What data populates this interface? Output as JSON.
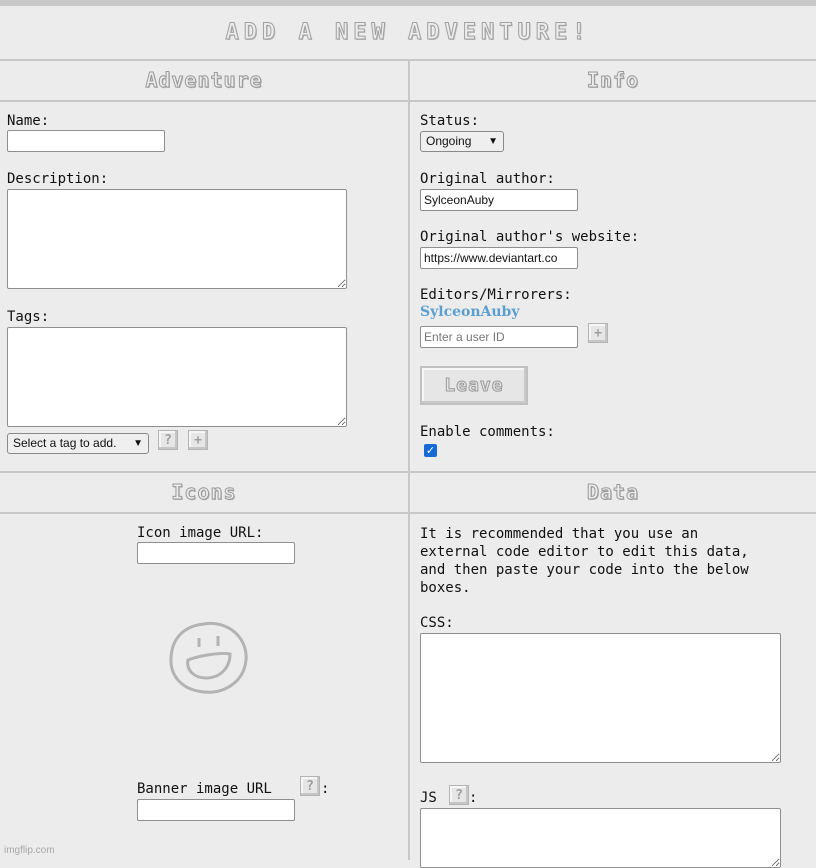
{
  "page_title": "ADD A NEW ADVENTURE!",
  "sections": {
    "adventure": "Adventure",
    "info": "Info",
    "icons": "Icons",
    "data": "Data"
  },
  "adventure": {
    "name_label": "Name:",
    "name_value": "",
    "description_label": "Description:",
    "tags_label": "Tags:",
    "tag_select_value": "Select a tag to add.",
    "help_glyph": "?",
    "add_glyph": "+"
  },
  "info": {
    "status_label": "Status:",
    "status_value": "Ongoing",
    "author_label": "Original author:",
    "author_value": "SylceonAuby",
    "website_label": "Original author's website:",
    "website_value": "https://www.deviantart.co",
    "editors_label": "Editors/Mirrorers:",
    "editor_name": "SylceonAuby",
    "user_id_placeholder": "Enter a user ID",
    "add_glyph": "+",
    "leave_label": "Leave",
    "comments_label": "Enable comments:",
    "comments_enabled": true,
    "check_glyph": "✓"
  },
  "icons": {
    "icon_url_label": "Icon image URL:",
    "banner_url_label": "Banner image URL",
    "banner_colon": ":",
    "help_glyph": "?",
    "placeholder_icon": "smiley-icon"
  },
  "data": {
    "note": "It is recommended that you use an\nexternal code editor to edit this data,\nand then paste your code into the below\nboxes.",
    "css_label": "CSS:",
    "js_label": "JS",
    "js_colon": ":",
    "help_glyph": "?"
  },
  "watermark": "imgflip.com",
  "colors": {
    "background": "#ececec",
    "divider": "#c8c8c8",
    "link": "#5b9fce",
    "checkbox": "#1769d6"
  }
}
